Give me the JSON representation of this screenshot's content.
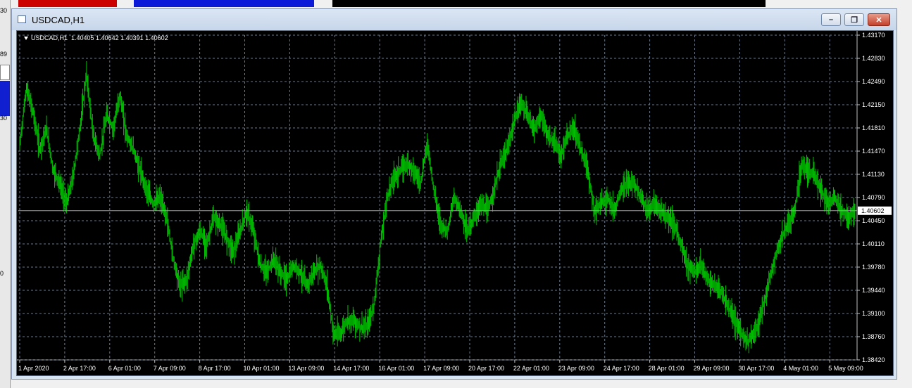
{
  "background": {
    "side_labels": [
      "30",
      "89",
      "30",
      "0"
    ]
  },
  "window": {
    "title": "USDCAD,H1",
    "buttons": {
      "minimize": "minimize-icon",
      "restore": "restore-icon",
      "close": "close-icon"
    }
  },
  "ohlc_label": "USDCAD,H1  1.40405 1.40642 1.40391 1.40602",
  "colors": {
    "candles": "#00c000",
    "background": "#000000",
    "grid": "#6e7a8a",
    "text": "#ffffff"
  },
  "chart_data": {
    "type": "line",
    "title": "",
    "symbol": "USDCAD",
    "timeframe": "H1",
    "current_price": "1.40602",
    "y_ticks": [
      "1.43170",
      "1.42830",
      "1.42490",
      "1.42150",
      "1.41810",
      "1.41470",
      "1.41130",
      "1.40790",
      "1.40450",
      "1.40110",
      "1.39780",
      "1.39440",
      "1.39100",
      "1.38760",
      "1.38420"
    ],
    "x_ticks": [
      "1 Apr 2020",
      "2 Apr 17:00",
      "6 Apr 01:00",
      "7 Apr 09:00",
      "8 Apr 17:00",
      "10 Apr 01:00",
      "13 Apr 09:00",
      "14 Apr 17:00",
      "16 Apr 01:00",
      "17 Apr 09:00",
      "20 Apr 17:00",
      "22 Apr 01:00",
      "23 Apr 09:00",
      "24 Apr 17:00",
      "28 Apr 01:00",
      "29 Apr 09:00",
      "30 Apr 17:00",
      "4 May 01:00",
      "5 May 09:00"
    ],
    "ylim": [
      1.3842,
      1.4317
    ],
    "series": [
      {
        "values": [
          1.4155,
          1.424,
          1.4205,
          1.415,
          1.418,
          1.412,
          1.41,
          1.407,
          1.411,
          1.418,
          1.426,
          1.417,
          1.414,
          1.42,
          1.418,
          1.423,
          1.417,
          1.415,
          1.412,
          1.409,
          1.407,
          1.408,
          1.405,
          1.399,
          1.395,
          1.396,
          1.401,
          1.403,
          1.401,
          1.405,
          1.404,
          1.402,
          1.4,
          1.403,
          1.406,
          1.403,
          1.398,
          1.397,
          1.399,
          1.397,
          1.396,
          1.398,
          1.397,
          1.395,
          1.397,
          1.398,
          1.395,
          1.388,
          1.388,
          1.39,
          1.39,
          1.389,
          1.389,
          1.392,
          1.401,
          1.408,
          1.411,
          1.412,
          1.413,
          1.412,
          1.41,
          1.416,
          1.409,
          1.404,
          1.403,
          1.408,
          1.406,
          1.403,
          1.405,
          1.407,
          1.406,
          1.409,
          1.413,
          1.415,
          1.419,
          1.422,
          1.42,
          1.418,
          1.42,
          1.417,
          1.416,
          1.414,
          1.417,
          1.418,
          1.415,
          1.412,
          1.406,
          1.407,
          1.408,
          1.406,
          1.409,
          1.41,
          1.41,
          1.408,
          1.406,
          1.407,
          1.406,
          1.405,
          1.404,
          1.401,
          1.398,
          1.397,
          1.398,
          1.396,
          1.395,
          1.394,
          1.392,
          1.39,
          1.388,
          1.387,
          1.388,
          1.391,
          1.395,
          1.399,
          1.402,
          1.404,
          1.406,
          1.413,
          1.412,
          1.411,
          1.409,
          1.407,
          1.408,
          1.406,
          1.405,
          1.406
        ]
      }
    ],
    "grid": true,
    "legend": "none"
  }
}
